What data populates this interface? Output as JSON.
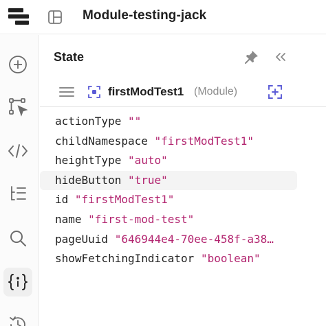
{
  "app": {
    "title": "Module-testing-jack"
  },
  "rail": {
    "items": [
      {
        "icon": "plus-circle-icon"
      },
      {
        "icon": "flow-select-icon"
      },
      {
        "icon": "code-icon"
      },
      {
        "icon": "tree-list-icon"
      },
      {
        "icon": "search-icon"
      },
      {
        "icon": "state-braces-icon",
        "active": true
      },
      {
        "icon": "history-icon"
      }
    ]
  },
  "panel": {
    "title": "State",
    "module": {
      "name": "firstModTest1",
      "type": "(Module)"
    },
    "state": [
      {
        "key": "actionType",
        "value": "\"\""
      },
      {
        "key": "childNamespace",
        "value": "\"firstModTest1\""
      },
      {
        "key": "heightType",
        "value": "\"auto\""
      },
      {
        "key": "hideButton",
        "value": "\"true\""
      },
      {
        "key": "id",
        "value": "\"firstModTest1\""
      },
      {
        "key": "name",
        "value": "\"first-mod-test\""
      },
      {
        "key": "pageUuid",
        "value": "\"646944e4-70ee-458f-a38…"
      },
      {
        "key": "showFetchingIndicator",
        "value": "\"boolean\""
      }
    ]
  },
  "colors": {
    "accent": "#5b5bd6",
    "string": "#b2246f",
    "text": "#1f1f1f",
    "muted": "#8d8d8d"
  }
}
